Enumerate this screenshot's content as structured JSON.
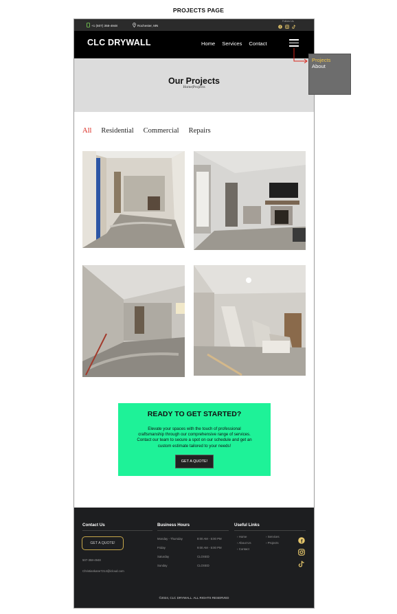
{
  "caption": "PROJECTS PAGE",
  "topbar": {
    "phone": "+1 (507) 358-4948",
    "location": "Rochester, MN",
    "follow_label": "Follow Us",
    "social_icons": [
      "facebook-icon",
      "instagram-icon",
      "tiktok-icon"
    ]
  },
  "navbar": {
    "brand": "CLC DRYWALL",
    "links": [
      "Home",
      "Services",
      "Contact"
    ]
  },
  "dropdown": {
    "items": [
      "Projects",
      "About"
    ]
  },
  "hero": {
    "title": "Our Projects",
    "breadcrumb": "Home|Projects"
  },
  "filters": {
    "tabs": [
      "All",
      "Residential",
      "Commercial",
      "Repairs"
    ],
    "active": "All"
  },
  "cta": {
    "title": "READY TO GET STARTED?",
    "body": "Elevate your spaces with the touch of professional craftsmanship through our comprehensive range of services. Contact our team to secure a spot on our schedule and get an custom estimate tailored to your needs!",
    "button": "GET A QUOTE!"
  },
  "footer": {
    "contact": {
      "title": "Contact Us",
      "button": "GET A QUOTE!",
      "phone": "507-358-4948",
      "email": "Christiankane7214@icloud.com"
    },
    "hours": {
      "title": "Business Hours",
      "rows": [
        {
          "day": "Monday - Thursday",
          "time": "8:00 AM - 5:00 PM"
        },
        {
          "day": "Friday",
          "time": "9:00 AM - 5:00 PM"
        },
        {
          "day": "Saturday",
          "time": "CLOSED"
        },
        {
          "day": "Sunday",
          "time": "CLOSED"
        }
      ]
    },
    "links": {
      "title": "Useful Links",
      "col1": [
        "Home",
        "About Us",
        "Contact"
      ],
      "col2": [
        "Services",
        "Projects"
      ]
    },
    "copyright": "©2024, CLC DRYWALL. ALL RIGHTS RESERVED"
  },
  "colors": {
    "accent_red": "#d9261c",
    "cta_green": "#1ef298",
    "gold": "#c8a84a",
    "dark": "#1d1e20"
  }
}
